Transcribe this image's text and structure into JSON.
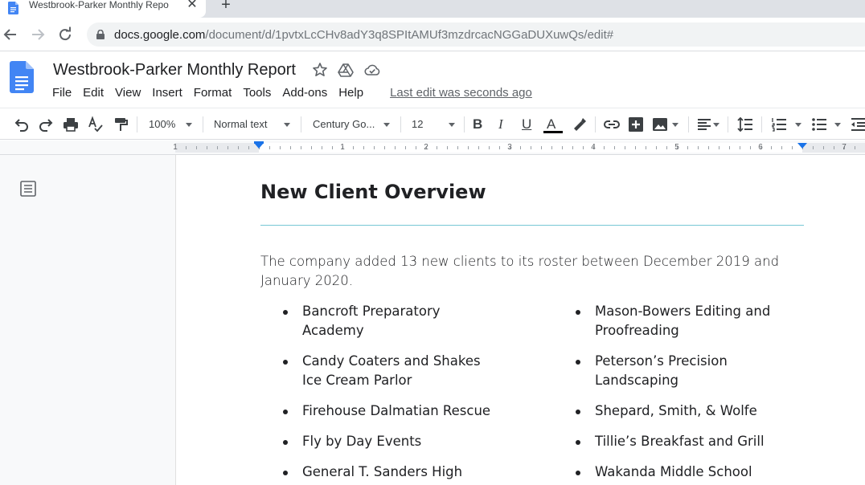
{
  "browser": {
    "tab_title": "Westbrook-Parker Monthly Repo",
    "tab_close": "✕",
    "new_tab": "+",
    "url_host": "docs.google.com",
    "url_path": "/document/d/1pvtxLcCHv8adY3q8SPItAMUf3mzdrcacNGGaDUXuwQs/edit#"
  },
  "docs": {
    "title": "Westbrook-Parker Monthly Report",
    "menu": [
      "File",
      "Edit",
      "View",
      "Insert",
      "Format",
      "Tools",
      "Add-ons",
      "Help"
    ],
    "last_edit": "Last edit was seconds ago"
  },
  "toolbar": {
    "zoom": "100%",
    "style": "Normal text",
    "font": "Century Go...",
    "font_size": "12",
    "bold": "B",
    "italic": "I",
    "underline": "U",
    "text_color_glyph": "A"
  },
  "ruler": {
    "numbers": [
      "1",
      "1",
      "2",
      "3",
      "4",
      "5",
      "6",
      "7"
    ]
  },
  "document": {
    "heading": "New Client Overview",
    "paragraph": "The company added 13 new clients to its roster between December 2019 and January 2020.",
    "left_list": [
      "Bancroft Preparatory Academy",
      "Candy Coaters and Shakes Ice Cream Parlor",
      "Firehouse Dalmatian Rescue",
      "Fly by Day Events",
      "General T. Sanders High"
    ],
    "right_list": [
      "Mason-Bowers Editing and Proofreading",
      "Peterson’s Precision Landscaping",
      "Shepard, Smith, & Wolfe",
      "Tillie’s Breakfast and Grill",
      "Wakanda Middle School"
    ]
  },
  "colors": {
    "docs_blue": "#4285f4",
    "heading_rule": "#76c7d4",
    "indent_marker": "#1a73e8"
  }
}
